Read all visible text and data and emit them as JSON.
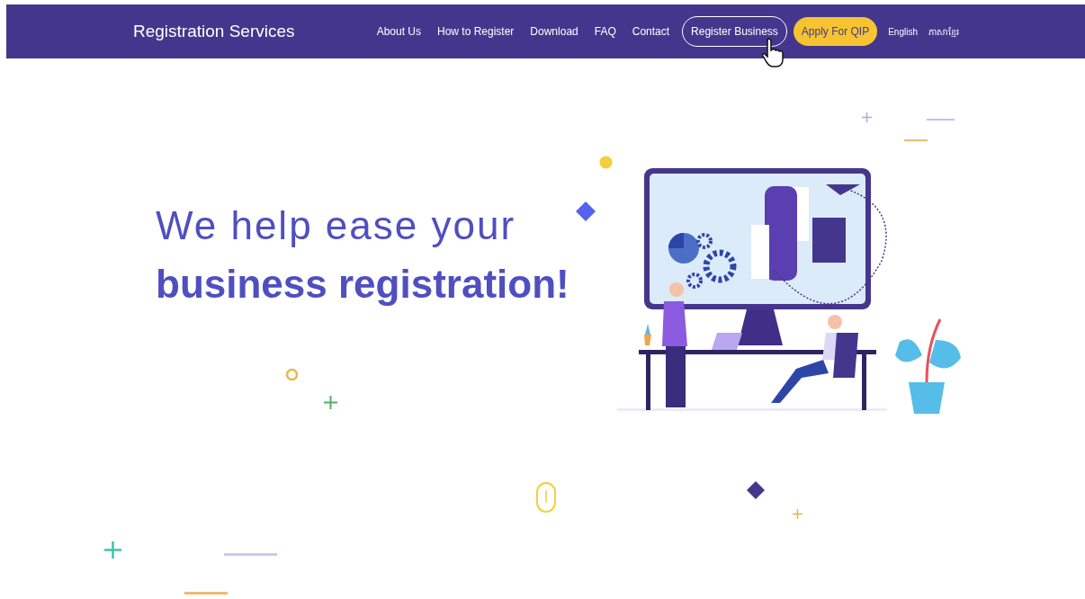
{
  "brand": "Registration Services",
  "nav": [
    {
      "label": "About Us",
      "kind": "link"
    },
    {
      "label": "How to Register",
      "kind": "link"
    },
    {
      "label": "Download",
      "kind": "link"
    },
    {
      "label": "FAQ",
      "kind": "link"
    },
    {
      "label": "Contact",
      "kind": "link"
    },
    {
      "label": "Register Business",
      "kind": "outline"
    },
    {
      "label": "Apply For QIP",
      "kind": "filled"
    }
  ],
  "languages": [
    {
      "label": "English"
    },
    {
      "label": "ភាសាខ្មែរ"
    }
  ],
  "hero": {
    "line_1": "We help ease your",
    "line_2": "business registration!"
  }
}
